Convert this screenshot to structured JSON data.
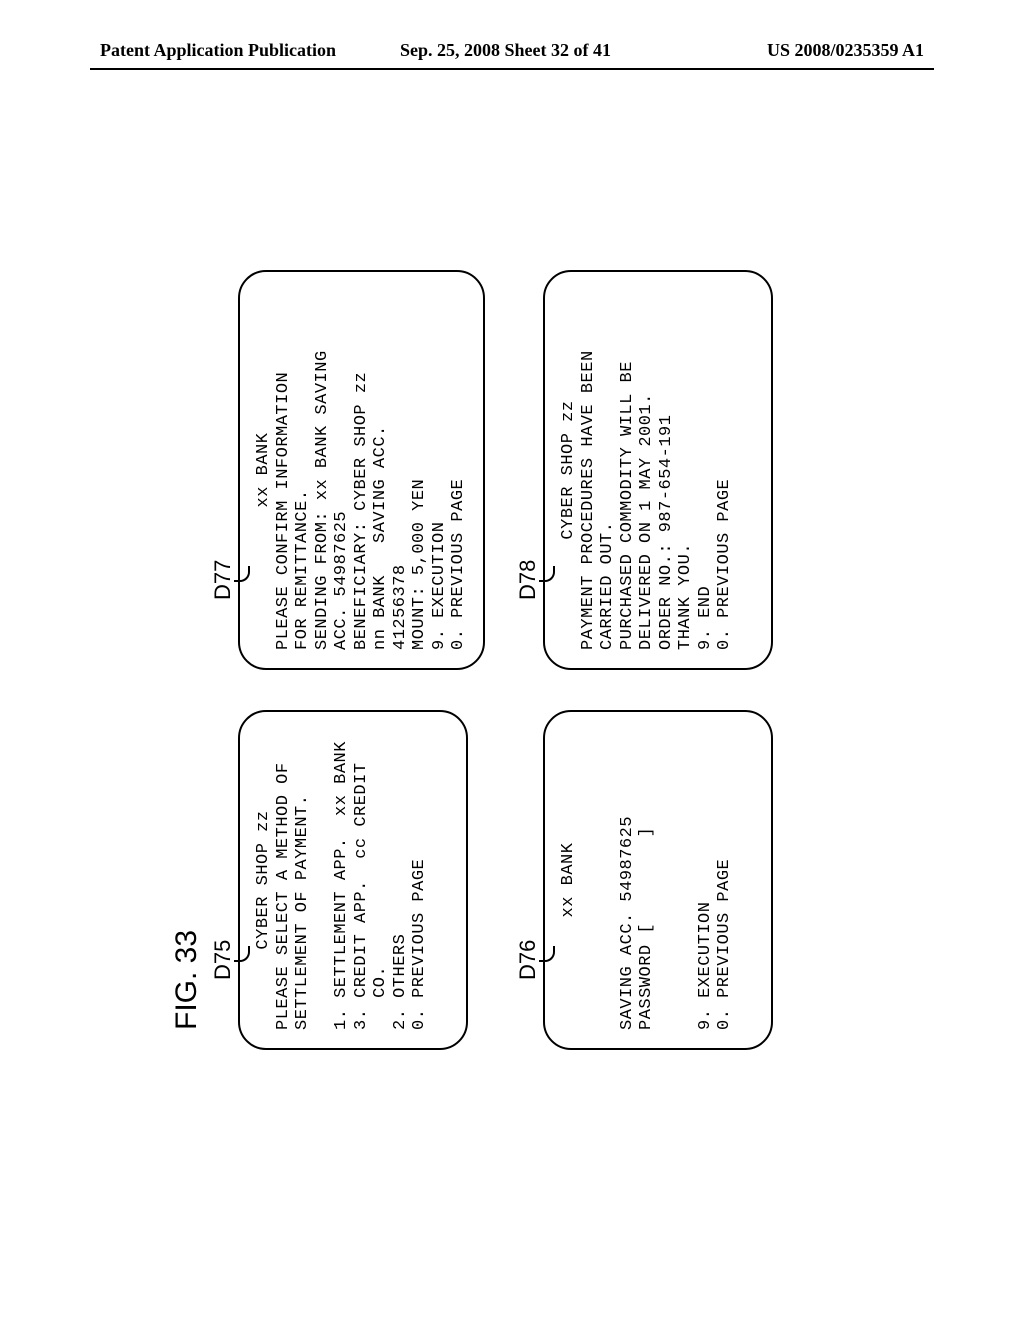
{
  "header": {
    "left": "Patent Application Publication",
    "center": "Sep. 25, 2008  Sheet 32 of 41",
    "right": "US 2008/0235359 A1"
  },
  "figure_label": "FIG. 33",
  "screens": {
    "d75": {
      "tag": "D75",
      "title": "CYBER SHOP zz",
      "line1": "PLEASE SELECT A METHOD OF",
      "line2": "SETTLEMENT OF PAYMENT.",
      "opt1": "1. SETTLEMENT APP.  xx BANK",
      "opt3": "3. CREDIT APP.  cc CREDIT",
      "opt3b": "   CO.",
      "opt2": "2. OTHERS",
      "opt0": "0. PREVIOUS PAGE"
    },
    "d77": {
      "tag": "D77",
      "title": "xx BANK",
      "l1": "PLEASE CONFIRM INFORMATION",
      "l2": "FOR REMITTANCE.",
      "l3": "SENDING FROM: xx BANK SAVING",
      "l4": "ACC. 54987625",
      "l5": "BENEFICIARY: CYBER SHOP zz",
      "l6": "nn BANK   SAVING ACC.",
      "l7": "41256378",
      "l8": "MOUNT: 5,000 YEN",
      "l9": "9. EXECUTION",
      "l10": "0. PREVIOUS PAGE"
    },
    "d76": {
      "tag": "D76",
      "title": "xx BANK",
      "l1": "SAVING ACC. 54987625",
      "l2": "PASSWORD [        ]",
      "l9": "9. EXECUTION",
      "l10": "0. PREVIOUS PAGE"
    },
    "d78": {
      "tag": "D78",
      "title": "CYBER SHOP zz",
      "l1": "PAYMENT PROCEDURES HAVE BEEN",
      "l2": "CARRIED OUT.",
      "l3": "PURCHASED COMMODITY WILL BE",
      "l4": "DELIVERED ON 1 MAY 2001.",
      "l5": "ORDER NO.: 987-654-191",
      "l6": "THANK YOU.",
      "l9": "9. END",
      "l10": "0. PREVIOUS PAGE"
    }
  }
}
